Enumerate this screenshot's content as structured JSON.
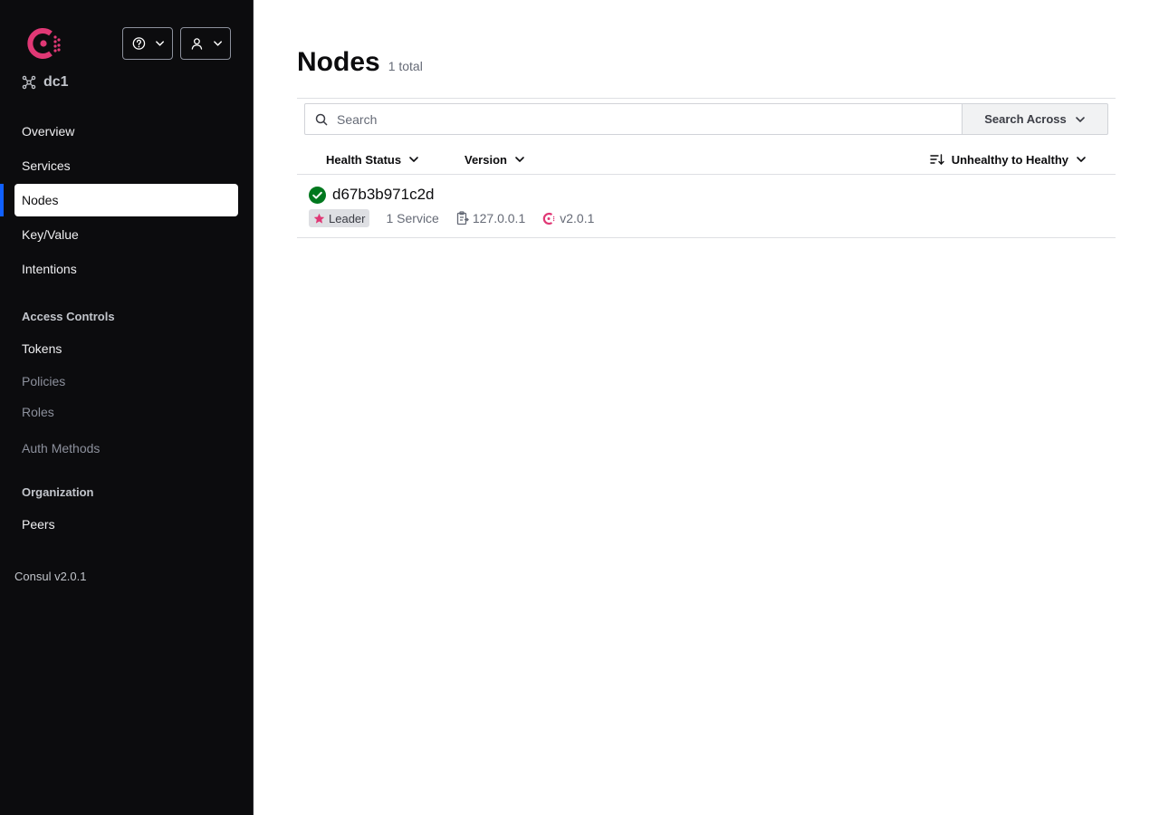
{
  "sidebar": {
    "datacenter": "dc1",
    "nav": {
      "overview": "Overview",
      "services": "Services",
      "nodes": "Nodes",
      "keyvalue": "Key/Value",
      "intentions": "Intentions"
    },
    "access_controls": {
      "heading": "Access Controls",
      "tokens": "Tokens",
      "policies": "Policies",
      "roles": "Roles",
      "auth_methods": "Auth Methods"
    },
    "organization": {
      "heading": "Organization",
      "peers": "Peers"
    },
    "version": "Consul v2.0.1"
  },
  "main": {
    "title": "Nodes",
    "count": "1 total",
    "search": {
      "placeholder": "Search",
      "value": ""
    },
    "search_across": "Search Across",
    "filters": {
      "health": "Health Status",
      "version": "Version",
      "sort": "Unhealthy to Healthy"
    },
    "nodes": [
      {
        "name": "d67b3b971c2d",
        "status": "passing",
        "badge": "Leader",
        "services": "1 Service",
        "address": "127.0.0.1",
        "version": "v2.0.1"
      }
    ]
  },
  "colors": {
    "brand": "#e03875",
    "sidebar_bg": "#0c0c0e",
    "active_indicator": "#1060ff",
    "healthy": "#00781e"
  }
}
